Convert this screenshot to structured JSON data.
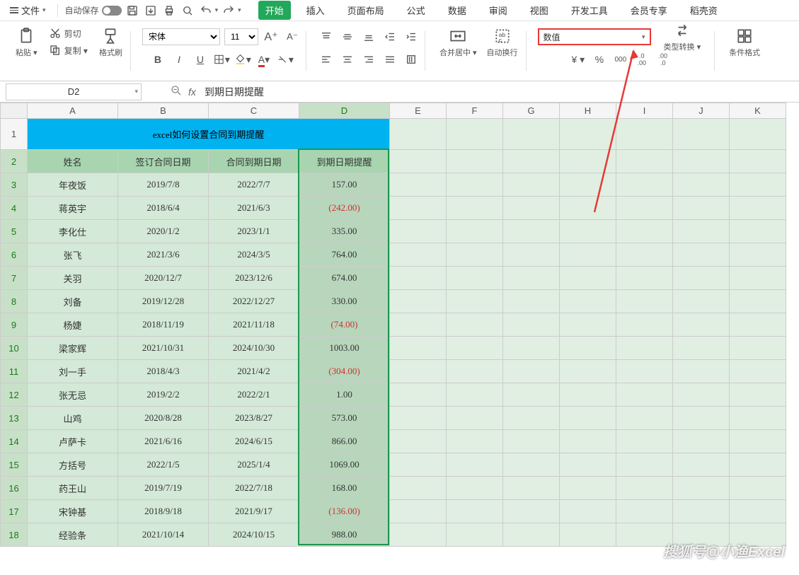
{
  "menubar": {
    "file": "文件",
    "autosave": "自动保存"
  },
  "tabs": [
    "开始",
    "插入",
    "页面布局",
    "公式",
    "数据",
    "审阅",
    "视图",
    "开发工具",
    "会员专享",
    "稻壳资"
  ],
  "active_tab_index": 0,
  "ribbon": {
    "paste": "粘贴",
    "cut": "剪切",
    "copy": "复制",
    "format_painter": "格式刷",
    "font_name": "宋体",
    "font_size": "11",
    "merge_center": "合并居中",
    "wrap_text": "自动换行",
    "number_format": "数值",
    "type_convert": "类型转换",
    "cond_format": "条件格式"
  },
  "namebox": "D2",
  "formula": "到期日期提醒",
  "columns": [
    "A",
    "B",
    "C",
    "D",
    "E",
    "F",
    "G",
    "H",
    "I",
    "J",
    "K"
  ],
  "selected_col": "D",
  "title_row": {
    "row": 1,
    "text": "excel如何设置合同到期提醒"
  },
  "header_row": {
    "row": 2,
    "cells": [
      "姓名",
      "签订合同日期",
      "合同到期日期",
      "到期日期提醒"
    ]
  },
  "data_rows": [
    {
      "row": 3,
      "name": "年夜饭",
      "sign": "2019/7/8",
      "due": "2022/7/7",
      "remind": "157.00",
      "neg": false
    },
    {
      "row": 4,
      "name": "蒋英宇",
      "sign": "2018/6/4",
      "due": "2021/6/3",
      "remind": "(242.00)",
      "neg": true
    },
    {
      "row": 5,
      "name": "李化仕",
      "sign": "2020/1/2",
      "due": "2023/1/1",
      "remind": "335.00",
      "neg": false
    },
    {
      "row": 6,
      "name": "张飞",
      "sign": "2021/3/6",
      "due": "2024/3/5",
      "remind": "764.00",
      "neg": false
    },
    {
      "row": 7,
      "name": "关羽",
      "sign": "2020/12/7",
      "due": "2023/12/6",
      "remind": "674.00",
      "neg": false
    },
    {
      "row": 8,
      "name": "刘备",
      "sign": "2019/12/28",
      "due": "2022/12/27",
      "remind": "330.00",
      "neg": false
    },
    {
      "row": 9,
      "name": "杨婕",
      "sign": "2018/11/19",
      "due": "2021/11/18",
      "remind": "(74.00)",
      "neg": true
    },
    {
      "row": 10,
      "name": "梁家辉",
      "sign": "2021/10/31",
      "due": "2024/10/30",
      "remind": "1003.00",
      "neg": false
    },
    {
      "row": 11,
      "name": "刘一手",
      "sign": "2018/4/3",
      "due": "2021/4/2",
      "remind": "(304.00)",
      "neg": true
    },
    {
      "row": 12,
      "name": "张无忌",
      "sign": "2019/2/2",
      "due": "2022/2/1",
      "remind": "1.00",
      "neg": false
    },
    {
      "row": 13,
      "name": "山鸡",
      "sign": "2020/8/28",
      "due": "2023/8/27",
      "remind": "573.00",
      "neg": false
    },
    {
      "row": 14,
      "name": "卢萨卡",
      "sign": "2021/6/16",
      "due": "2024/6/15",
      "remind": "866.00",
      "neg": false
    },
    {
      "row": 15,
      "name": "方括号",
      "sign": "2022/1/5",
      "due": "2025/1/4",
      "remind": "1069.00",
      "neg": false
    },
    {
      "row": 16,
      "name": "药王山",
      "sign": "2019/7/19",
      "due": "2022/7/18",
      "remind": "168.00",
      "neg": false
    },
    {
      "row": 17,
      "name": "宋钟基",
      "sign": "2018/9/18",
      "due": "2021/9/17",
      "remind": "(136.00)",
      "neg": true
    },
    {
      "row": 18,
      "name": "经验条",
      "sign": "2021/10/14",
      "due": "2024/10/15",
      "remind": "988.00",
      "neg": false
    }
  ],
  "watermark": "搜狐号@小渔Excel"
}
